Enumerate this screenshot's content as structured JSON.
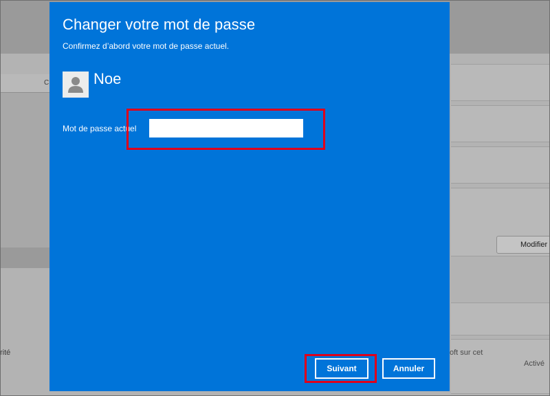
{
  "background": {
    "left_tab_text": "C",
    "left_text": "rité",
    "modify_button_label": "Modifier",
    "right_text_1": "oft sur cet",
    "right_text_2": "Activé"
  },
  "dialog": {
    "title": "Changer votre mot de passe",
    "subtitle": "Confirmez d’abord votre mot de passe actuel.",
    "user_name": "Noe",
    "avatar_icon": "user-avatar-icon",
    "field_label": "Mot de passe actuel",
    "password_value": "",
    "next_label": "Suivant",
    "cancel_label": "Annuler",
    "colors": {
      "dialog_background": "#0074d9",
      "highlight": "#e0001a"
    }
  }
}
